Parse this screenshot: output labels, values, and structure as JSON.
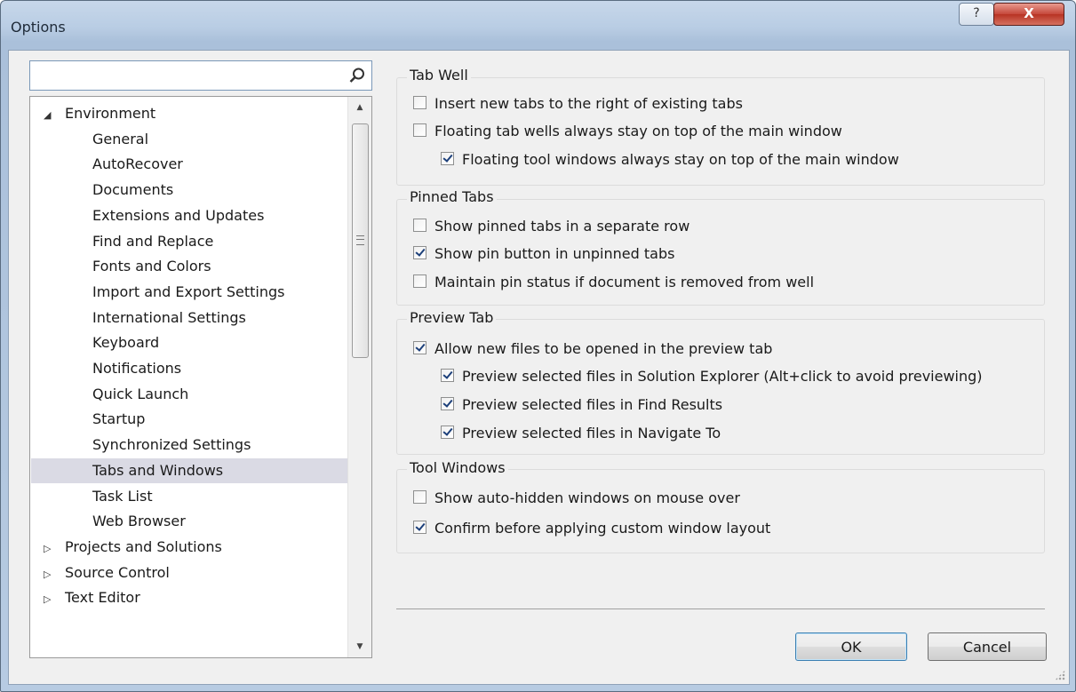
{
  "window": {
    "title": "Options",
    "help_glyph": "?",
    "close_glyph": "X"
  },
  "search": {
    "value": "",
    "placeholder": ""
  },
  "tree": {
    "items": [
      {
        "label": "Environment",
        "level": 0,
        "expander": "expanded"
      },
      {
        "label": "General",
        "level": 1
      },
      {
        "label": "AutoRecover",
        "level": 1
      },
      {
        "label": "Documents",
        "level": 1
      },
      {
        "label": "Extensions and Updates",
        "level": 1
      },
      {
        "label": "Find and Replace",
        "level": 1
      },
      {
        "label": "Fonts and Colors",
        "level": 1
      },
      {
        "label": "Import and Export Settings",
        "level": 1
      },
      {
        "label": "International Settings",
        "level": 1
      },
      {
        "label": "Keyboard",
        "level": 1
      },
      {
        "label": "Notifications",
        "level": 1
      },
      {
        "label": "Quick Launch",
        "level": 1
      },
      {
        "label": "Startup",
        "level": 1
      },
      {
        "label": "Synchronized Settings",
        "level": 1
      },
      {
        "label": "Tabs and Windows",
        "level": 1,
        "selected": true
      },
      {
        "label": "Task List",
        "level": 1
      },
      {
        "label": "Web Browser",
        "level": 1
      },
      {
        "label": "Projects and Solutions",
        "level": 0,
        "expander": "collapsed"
      },
      {
        "label": "Source Control",
        "level": 0,
        "expander": "collapsed"
      },
      {
        "label": "Text Editor",
        "level": 0,
        "expander": "collapsed"
      }
    ]
  },
  "groups": {
    "tab_well": {
      "title": "Tab Well",
      "options": [
        {
          "label": "Insert new tabs to the right of existing tabs",
          "checked": false
        },
        {
          "label": "Floating tab wells always stay on top of the main window",
          "checked": false
        },
        {
          "label": "Floating tool windows always stay on top of the main window",
          "checked": true
        }
      ]
    },
    "pinned_tabs": {
      "title": "Pinned Tabs",
      "options": [
        {
          "label": "Show pinned tabs in a separate row",
          "checked": false
        },
        {
          "label": "Show pin button in unpinned tabs",
          "checked": true
        },
        {
          "label": "Maintain pin status if document is removed from well",
          "checked": false
        }
      ]
    },
    "preview_tab": {
      "title": "Preview Tab",
      "options": [
        {
          "label": "Allow new files to be opened in the preview tab",
          "checked": true
        },
        {
          "label": "Preview selected files in Solution Explorer (Alt+click to avoid previewing)",
          "checked": true
        },
        {
          "label": "Preview selected files in Find Results",
          "checked": true
        },
        {
          "label": "Preview selected files in Navigate To",
          "checked": true
        }
      ]
    },
    "tool_windows": {
      "title": "Tool Windows",
      "options": [
        {
          "label": "Show auto-hidden windows on mouse over",
          "checked": false
        },
        {
          "label": "Confirm before applying custom window layout",
          "checked": true
        }
      ]
    }
  },
  "buttons": {
    "ok": "OK",
    "cancel": "Cancel"
  },
  "icons": {
    "search": "search-icon",
    "expanded": "triangle-down-icon",
    "collapsed": "triangle-right-icon"
  }
}
